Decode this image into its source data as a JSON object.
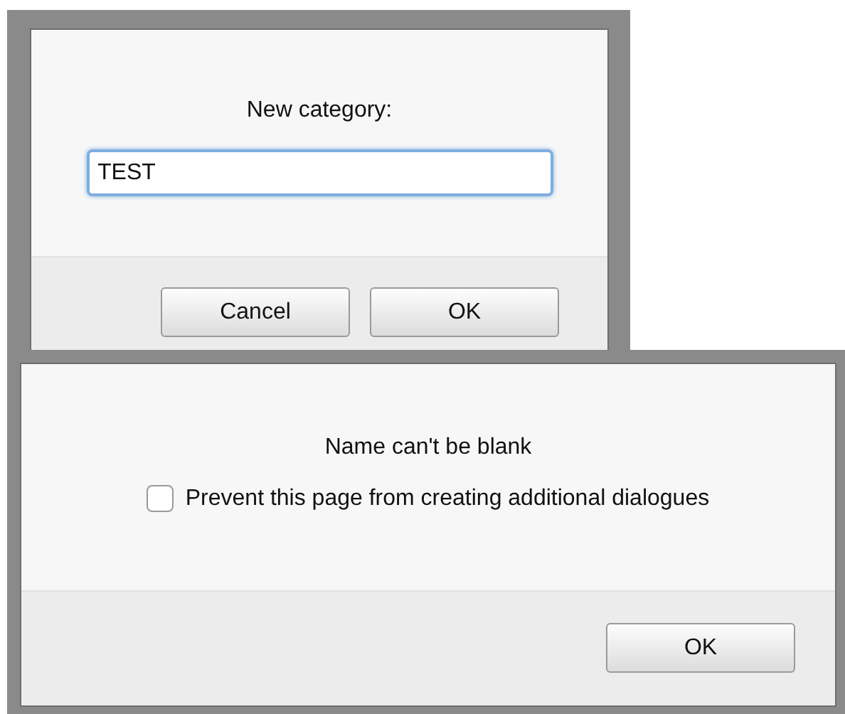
{
  "dialogs": [
    {
      "kind": "prompt",
      "message": "New category:",
      "input": {
        "value": "TEST",
        "focused": true
      },
      "buttons": [
        {
          "label": "Cancel",
          "default": false
        },
        {
          "label": "OK",
          "default": false
        }
      ]
    },
    {
      "kind": "alert",
      "message": "Name can't be blank",
      "checkbox": {
        "label": "Prevent this page from creating additional dialogues",
        "checked": false
      },
      "buttons": [
        {
          "label": "OK",
          "default": false
        }
      ]
    }
  ]
}
